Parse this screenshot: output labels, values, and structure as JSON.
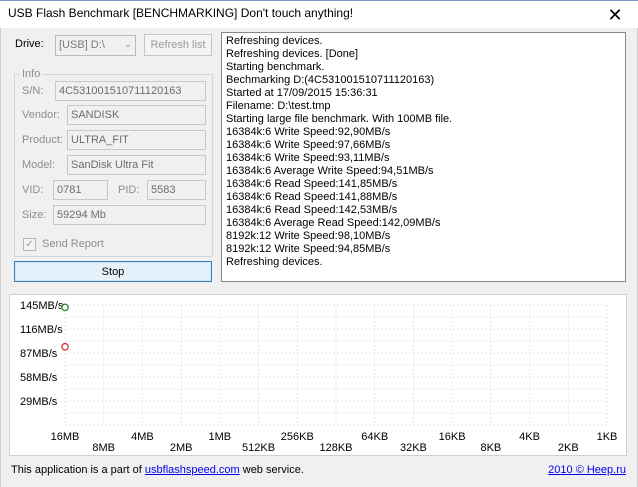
{
  "window": {
    "title": "USB Flash Benchmark [BENCHMARKING] Don't touch anything!",
    "close_glyph": "✕"
  },
  "drive": {
    "label": "Drive:",
    "value": "[USB] D:\\",
    "refresh_label": "Refresh list"
  },
  "info": {
    "title": "Info",
    "sn_label": "S/N:",
    "sn": "4C531001510711120163",
    "vendor_label": "Vendor:",
    "vendor": "SANDISK",
    "product_label": "Product:",
    "product": "ULTRA_FIT",
    "model_label": "Model:",
    "model": "SanDisk Ultra Fit",
    "vid_label": "VID:",
    "vid": "0781",
    "pid_label": "PID:",
    "pid": "5583",
    "size_label": "Size:",
    "size": "59294 Mb"
  },
  "send_report": {
    "label": "Send Report",
    "checked": true
  },
  "stop_label": "Stop",
  "log": [
    "Refreshing devices.",
    "Refreshing devices. [Done]",
    "Starting benchmark.",
    "Bechmarking D:(4C531001510711120163)",
    "Started at 17/09/2015 15:36:31",
    "Filename: D:\\test.tmp",
    "Starting large file benchmark. With 100MB file.",
    "16384k:6 Write Speed:92,90MB/s",
    "16384k:6 Write Speed:97,66MB/s",
    "16384k:6 Write Speed:93,11MB/s",
    "16384k:6 Average Write Speed:94,51MB/s",
    "16384k:6 Read Speed:141,85MB/s",
    "16384k:6 Read Speed:141,88MB/s",
    "16384k:6 Read Speed:142,53MB/s",
    "16384k:6 Average Read Speed:142,09MB/s",
    "8192k:12 Write Speed:98,10MB/s",
    "8192k:12 Write Speed:94,85MB/s",
    "Refreshing devices."
  ],
  "chart_data": {
    "type": "scatter",
    "title": "",
    "xlabel": "",
    "ylabel": "",
    "y_ticks": [
      "145MB/s",
      "116MB/s",
      "87MB/s",
      "58MB/s",
      "29MB/s"
    ],
    "y_tick_values": [
      145,
      116,
      87,
      58,
      29
    ],
    "ylim": [
      0,
      145
    ],
    "x_ticks_upper": [
      "16MB",
      "4MB",
      "1MB",
      "256KB",
      "64KB",
      "16KB",
      "4KB",
      "1KB"
    ],
    "x_ticks_lower": [
      "8MB",
      "2MB",
      "512KB",
      "128KB",
      "32KB",
      "8KB",
      "2KB"
    ],
    "x_categories": [
      "16MB",
      "8MB",
      "4MB",
      "2MB",
      "1MB",
      "512KB",
      "256KB",
      "128KB",
      "64KB",
      "32KB",
      "16KB",
      "8KB",
      "4KB",
      "2KB",
      "1KB"
    ],
    "grid": true,
    "series": [
      {
        "name": "",
        "color": "#2e8b2e",
        "points": [
          {
            "x": "16MB",
            "y": 142.09
          }
        ]
      },
      {
        "name": "",
        "color": "#e03030",
        "points": [
          {
            "x": "16MB",
            "y": 94.51
          }
        ]
      }
    ]
  },
  "footer": {
    "prefix": "This application is a part of ",
    "link": "usbflashspeed.com",
    "suffix": " web service.",
    "copyright": "2010 © Heep.ru"
  }
}
